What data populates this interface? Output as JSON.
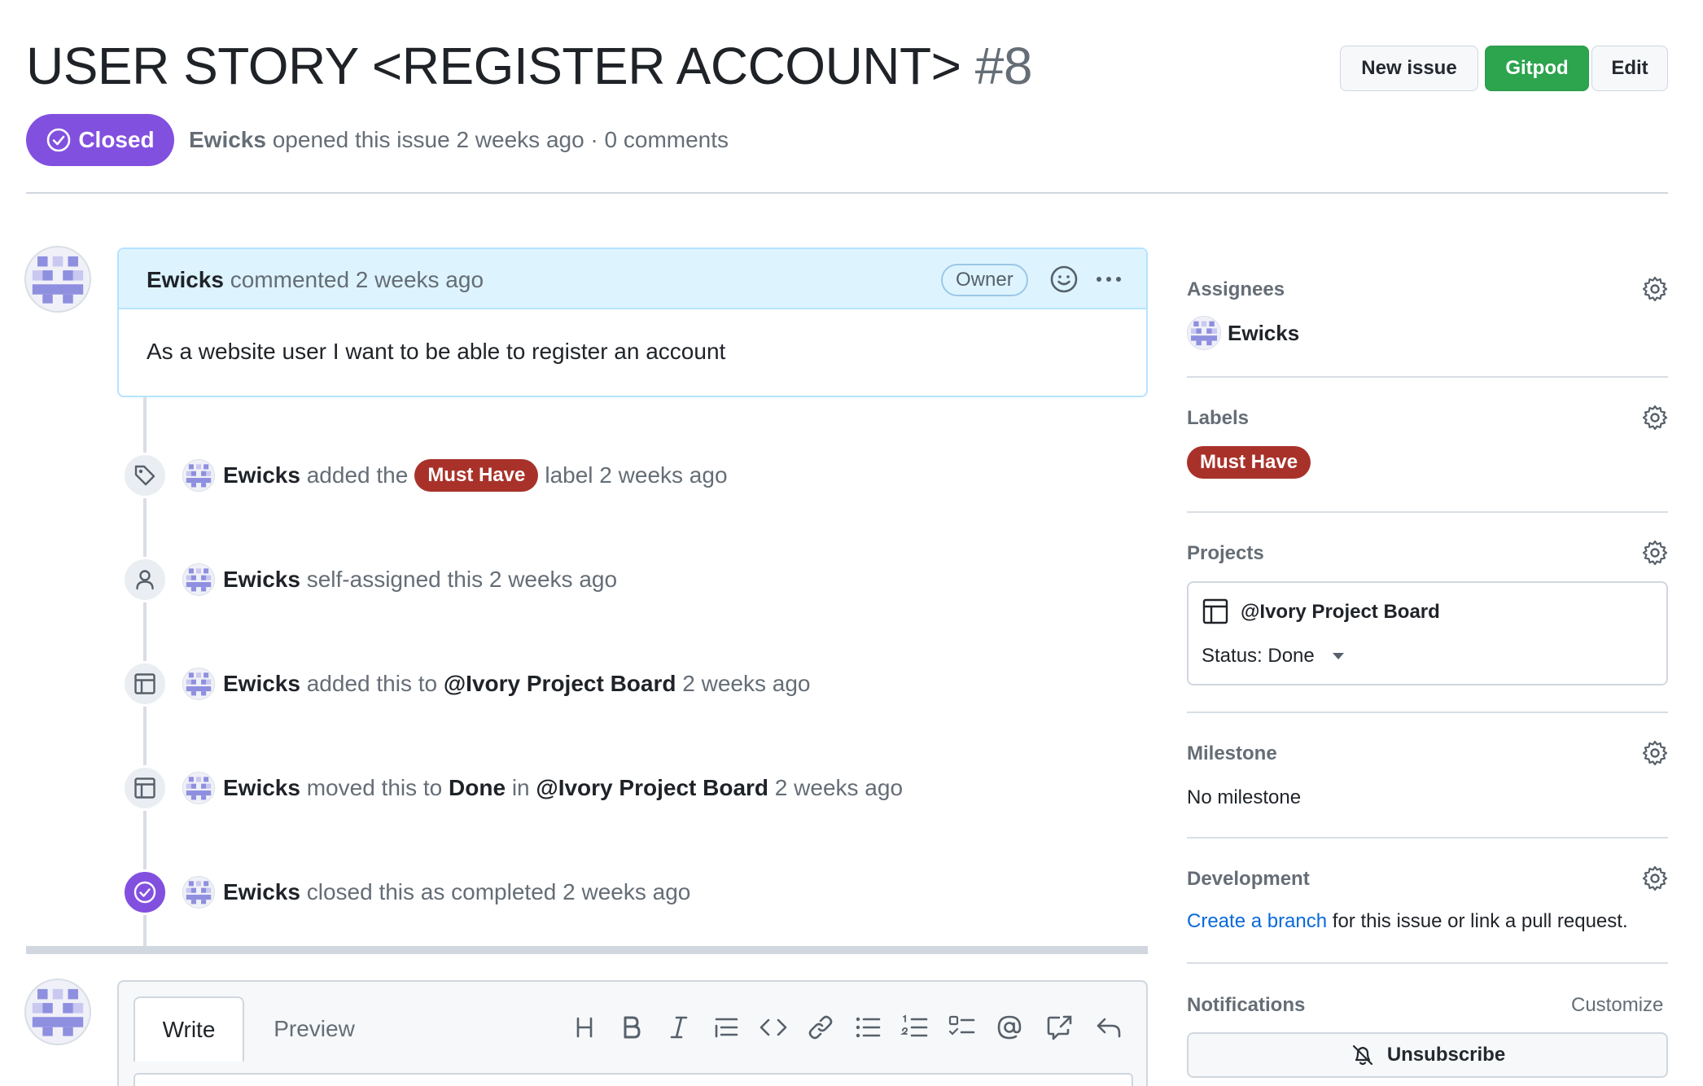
{
  "issue": {
    "title": "USER STORY <REGISTER ACCOUNT>",
    "number": "#8",
    "state": "Closed",
    "author": "Ewicks",
    "opened_text": "opened this issue 2 weeks ago · 0 comments"
  },
  "header_buttons": {
    "new_issue": "New issue",
    "gitpod": "Gitpod",
    "edit": "Edit"
  },
  "comment": {
    "author": "Ewicks",
    "action": "commented 2 weeks ago",
    "role_badge": "Owner",
    "body": "As a website user I want to be able to register an account"
  },
  "timeline": [
    {
      "icon": "tag-icon",
      "actor": "Ewicks",
      "pre": "added the",
      "label": "Must Have",
      "post": "label 2 weeks ago"
    },
    {
      "icon": "person-icon",
      "actor": "Ewicks",
      "pre": "self-assigned this 2 weeks ago"
    },
    {
      "icon": "table-icon",
      "actor": "Ewicks",
      "pre": "added this to",
      "target": "@Ivory Project Board",
      "post": "2 weeks ago"
    },
    {
      "icon": "table-icon",
      "actor": "Ewicks",
      "pre": "moved this to",
      "status": "Done",
      "mid": "in",
      "target": "@Ivory Project Board",
      "post": "2 weeks ago"
    },
    {
      "icon": "check-circle-icon",
      "actor": "Ewicks",
      "pre": "closed this as completed 2 weeks ago"
    }
  ],
  "editor": {
    "tabs": [
      "Write",
      "Preview"
    ],
    "tools": [
      "heading-icon",
      "bold-icon",
      "italic-icon",
      "quote-icon",
      "code-icon",
      "link-icon",
      "bulleted-list-icon",
      "numbered-list-icon",
      "task-list-icon",
      "mention-icon",
      "cross-reference-icon",
      "reply-icon"
    ]
  },
  "sidebar": {
    "assignees": {
      "heading": "Assignees",
      "user": "Ewicks"
    },
    "labels": {
      "heading": "Labels",
      "label": "Must Have",
      "label_color": "#a8322a"
    },
    "projects": {
      "heading": "Projects",
      "name": "@Ivory Project Board",
      "status": "Status: Done"
    },
    "milestone": {
      "heading": "Milestone",
      "value": "No milestone"
    },
    "development": {
      "heading": "Development",
      "link": "Create a branch",
      "rest": "for this issue or link a pull request."
    },
    "notifications": {
      "heading": "Notifications",
      "customize": "Customize",
      "unsubscribe": "Unsubscribe"
    }
  },
  "colors": {
    "closed_purple": "#8250df",
    "gitpod_green": "#2da44e",
    "link_blue": "#0969da",
    "comment_header_bg": "#ddf4ff"
  }
}
